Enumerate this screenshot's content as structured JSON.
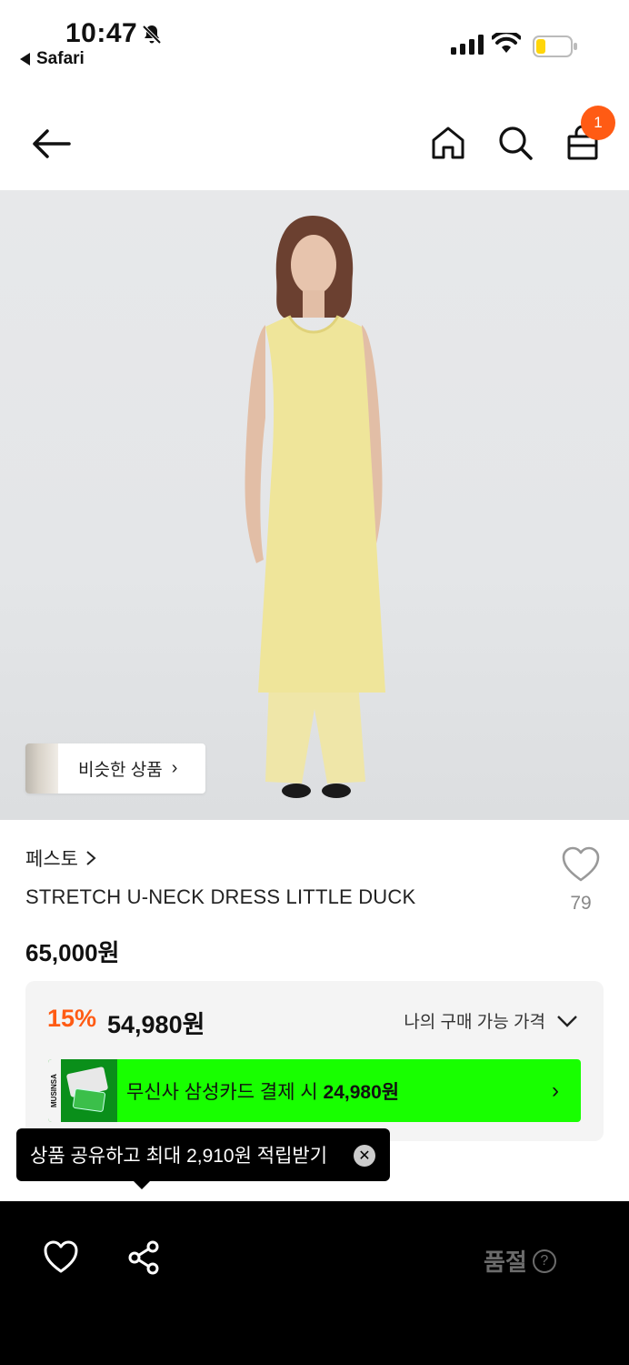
{
  "status_bar": {
    "time": "10:47",
    "back_app": "Safari"
  },
  "navbar": {
    "cart_badge": "1"
  },
  "hero": {
    "similar_label": "비슷한 상품"
  },
  "product": {
    "brand": "페스토",
    "name": "STRETCH U-NECK DRESS LITTLE DUCK",
    "like_count": "79",
    "original_price": "65,000원"
  },
  "price_box": {
    "discount_percent": "15%",
    "discount_price": "54,980원",
    "my_price_label": "나의 구매 가능 가격",
    "card_banner_text": "무신사 삼성카드 결제 시",
    "card_banner_price": "24,980원",
    "card_brand_text": "MUSINSA"
  },
  "tooltip": {
    "text": "상품 공유하고 최대 2,910원 적립받기"
  },
  "bottom_bar": {
    "soldout_label": "품절",
    "help_symbol": "?"
  },
  "colors": {
    "accent": "#ff5b14",
    "card_green": "#18ff00",
    "dress_yellow": "#efe59a"
  }
}
